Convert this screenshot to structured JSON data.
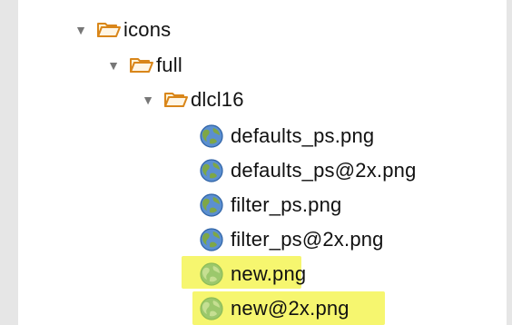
{
  "tree": {
    "folders": [
      {
        "label": "icons",
        "expanded": true
      },
      {
        "label": "full",
        "expanded": true
      },
      {
        "label": "dlcl16",
        "expanded": true
      }
    ],
    "files": [
      {
        "label": "defaults_ps.png",
        "icon": "globe-icon",
        "highlighted": false
      },
      {
        "label": "defaults_ps@2x.png",
        "icon": "globe-icon",
        "highlighted": false
      },
      {
        "label": "filter_ps.png",
        "icon": "globe-icon",
        "highlighted": false
      },
      {
        "label": "filter_ps@2x.png",
        "icon": "globe-icon",
        "highlighted": false
      },
      {
        "label": "new.png",
        "icon": "globe-icon",
        "highlighted": true
      },
      {
        "label": "new@2x.png",
        "icon": "globe-icon",
        "highlighted": true
      }
    ]
  },
  "colors": {
    "highlight": "#f6f66f",
    "folder_stroke": "#d9861a",
    "globe_blue": "#4d7fc0",
    "globe_green": "#7ea746"
  }
}
